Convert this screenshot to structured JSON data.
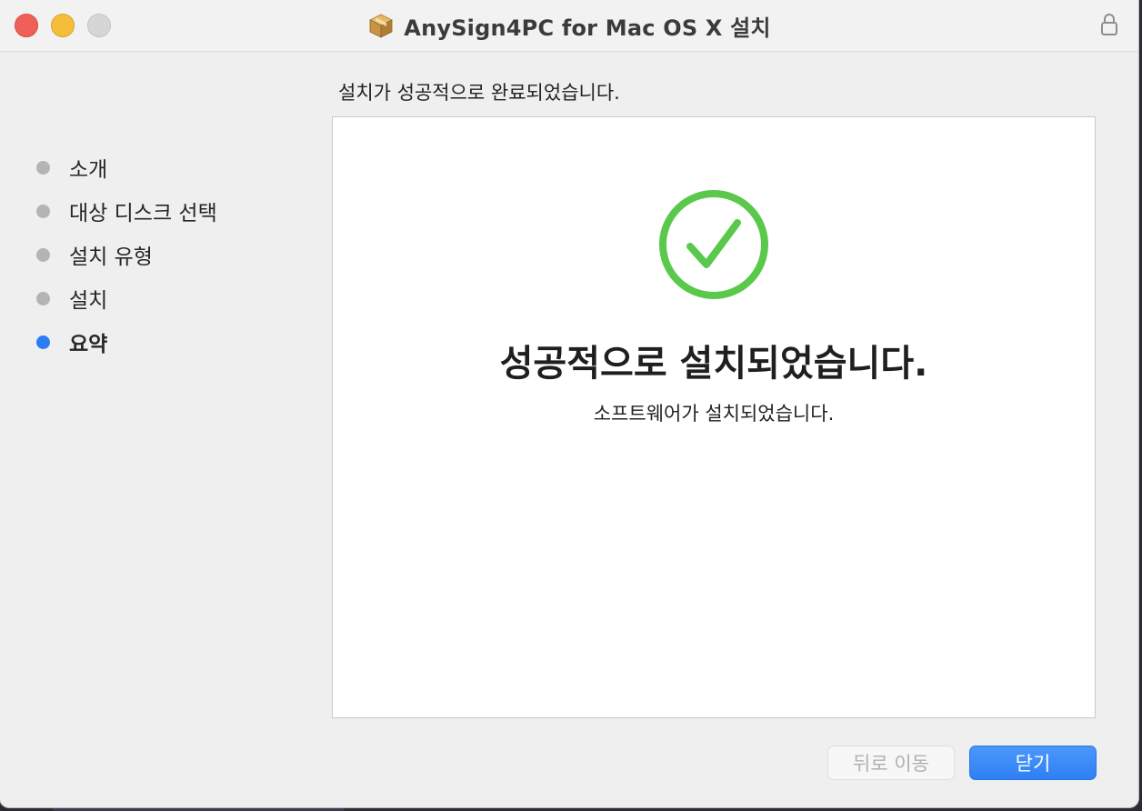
{
  "window": {
    "title": "AnySign4PC for Mac OS X 설치",
    "title_icon": "package-icon",
    "lock_icon": "lock-icon"
  },
  "sidebar": {
    "items": [
      {
        "label": "소개",
        "active": false
      },
      {
        "label": "대상 디스크 선택",
        "active": false
      },
      {
        "label": "설치 유형",
        "active": false
      },
      {
        "label": "설치",
        "active": false
      },
      {
        "label": "요약",
        "active": true
      }
    ]
  },
  "main": {
    "heading": "설치가 성공적으로 완료되었습니다.",
    "success_icon": "checkmark-circle-icon",
    "success_title": "성공적으로 설치되었습니다.",
    "success_subtitle": "소프트웨어가 설치되었습니다."
  },
  "buttons": {
    "back_label": "뒤로 이동",
    "close_label": "닫기"
  },
  "colors": {
    "accent": "#2d7cf6",
    "success": "#5ac94b",
    "inactive_dot": "#b4b4b4"
  }
}
